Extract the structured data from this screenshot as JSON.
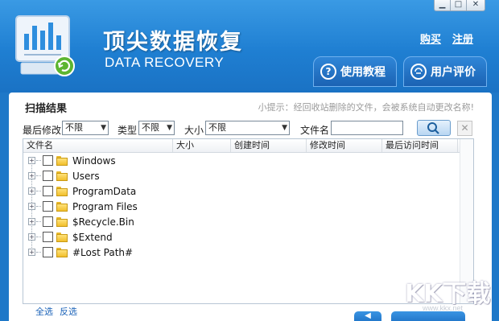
{
  "window": {
    "controls": {
      "minimize": "▁",
      "maximize": "□",
      "close": "✕"
    }
  },
  "header": {
    "title_cn": "顶尖数据恢复",
    "title_en": "DATA RECOVERY",
    "buy_label": "购买",
    "register_label": "注册",
    "tutorial_label": "使用教程",
    "tutorial_icon_glyph": "?",
    "review_label": "用户评价",
    "logo_icon": "bar-chart-document-refresh-icon"
  },
  "main": {
    "section_title": "扫描结果",
    "tip": "小提示：经回收站删除的文件，会被系统自动更改名称!",
    "filters": {
      "last_modified_label": "最后修改",
      "last_modified_value": "不限",
      "type_label": "类型",
      "type_value": "不限",
      "size_label": "大小",
      "size_value": "不限",
      "filename_label": "文件名",
      "filename_value": "",
      "clear_glyph": "✕"
    },
    "table": {
      "columns": [
        "文件名",
        "大小",
        "创建时间",
        "修改时间",
        "最后访问时间"
      ],
      "rows": [
        {
          "name": "Windows"
        },
        {
          "name": "Users"
        },
        {
          "name": "ProgramData"
        },
        {
          "name": "Program Files"
        },
        {
          "name": "$Recycle.Bin"
        },
        {
          "name": "$Extend"
        },
        {
          "name": "#Lost Path#"
        }
      ]
    },
    "bottom": {
      "select_all": "全选",
      "invert_selection": "反选"
    }
  },
  "watermark": {
    "text": "KK下载",
    "sub": "www.kkx.net"
  },
  "colors": {
    "header_blue": "#1f7fd2",
    "link_blue": "#1a62b8",
    "folder_yellow": "#f1bf2c"
  }
}
